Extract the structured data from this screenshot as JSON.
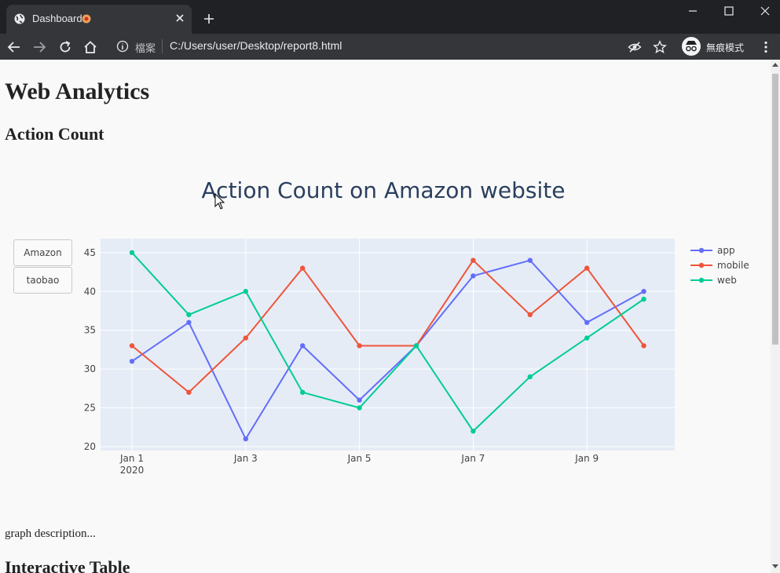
{
  "browser": {
    "tab_title": "Dashboard",
    "address_label": "檔案",
    "url": "C:/Users/user/Desktop/report8.html",
    "incognito_label": "無痕模式"
  },
  "page": {
    "h1": "Web Analytics",
    "section1": "Action Count",
    "section2": "Interactive Table",
    "description": "graph description..."
  },
  "buttons": [
    "Amazon",
    "taobao"
  ],
  "colors": {
    "app": "#636efa",
    "mobile": "#EF553B",
    "web": "#00cc96",
    "plot_bg": "#e5ecf6"
  },
  "chart_data": {
    "type": "line",
    "title": "Action Count on Amazon website",
    "x": [
      "2020-01-01",
      "2020-01-02",
      "2020-01-03",
      "2020-01-04",
      "2020-01-05",
      "2020-01-06",
      "2020-01-07",
      "2020-01-08",
      "2020-01-09",
      "2020-01-10"
    ],
    "xticks": [
      "Jan 1",
      "Jan 3",
      "Jan 5",
      "Jan 7",
      "Jan 9"
    ],
    "xtick_year": "2020",
    "yticks": [
      "20",
      "25",
      "30",
      "35",
      "40",
      "45"
    ],
    "ylim": [
      19.5,
      46.8
    ],
    "series": [
      {
        "name": "app",
        "values": [
          31,
          36,
          21,
          33,
          26,
          33,
          42,
          44,
          36,
          40
        ]
      },
      {
        "name": "mobile",
        "values": [
          33,
          27,
          34,
          43,
          33,
          33,
          44,
          37,
          43,
          33
        ]
      },
      {
        "name": "web",
        "values": [
          45,
          37,
          40,
          27,
          25,
          33,
          22,
          29,
          34,
          39
        ]
      }
    ],
    "legend": "top-right",
    "grid": true
  }
}
